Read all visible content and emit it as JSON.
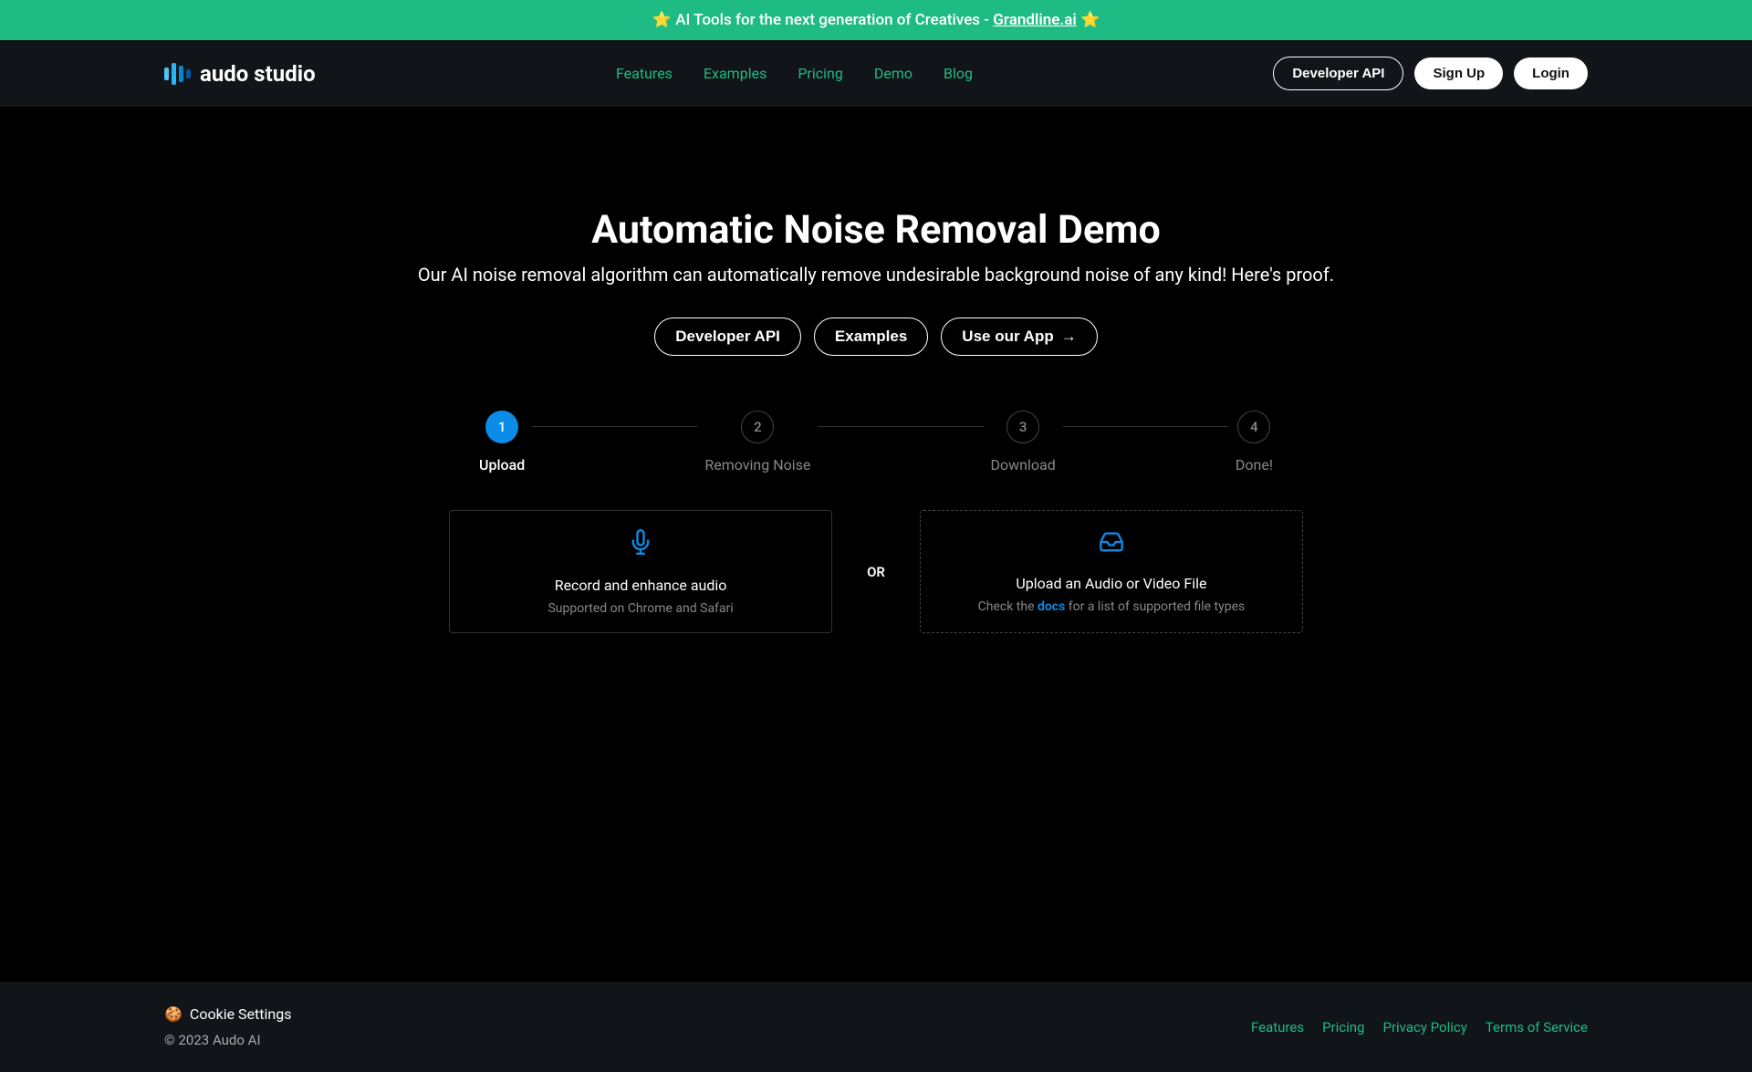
{
  "banner": {
    "text_prefix": "AI Tools for the next generation of Creatives - ",
    "link_text": "Grandline.ai",
    "star": "⭐"
  },
  "logo": {
    "text": "audo studio"
  },
  "nav": {
    "items": [
      "Features",
      "Examples",
      "Pricing",
      "Demo",
      "Blog"
    ],
    "developer_api": "Developer API",
    "signup": "Sign Up",
    "login": "Login"
  },
  "hero": {
    "title": "Automatic Noise Removal Demo",
    "subtitle": "Our AI noise removal algorithm can automatically remove undesirable background noise of any kind! Here's proof.",
    "buttons": {
      "developer_api": "Developer API",
      "examples": "Examples",
      "use_app": "Use our App"
    }
  },
  "steps": [
    {
      "num": "1",
      "label": "Upload",
      "active": true
    },
    {
      "num": "2",
      "label": "Removing Noise",
      "active": false
    },
    {
      "num": "3",
      "label": "Download",
      "active": false
    },
    {
      "num": "4",
      "label": "Done!",
      "active": false
    }
  ],
  "upload": {
    "record": {
      "title": "Record and enhance audio",
      "subtitle": "Supported on Chrome and Safari"
    },
    "or": "OR",
    "file": {
      "title": "Upload an Audio or Video File",
      "subtitle_prefix": "Check the ",
      "docs": "docs",
      "subtitle_suffix": " for a list of supported file types"
    }
  },
  "footer": {
    "cookie": "Cookie Settings",
    "copyright": "© 2023 Audo AI",
    "links": [
      "Features",
      "Pricing",
      "Privacy Policy",
      "Terms of Service"
    ]
  }
}
